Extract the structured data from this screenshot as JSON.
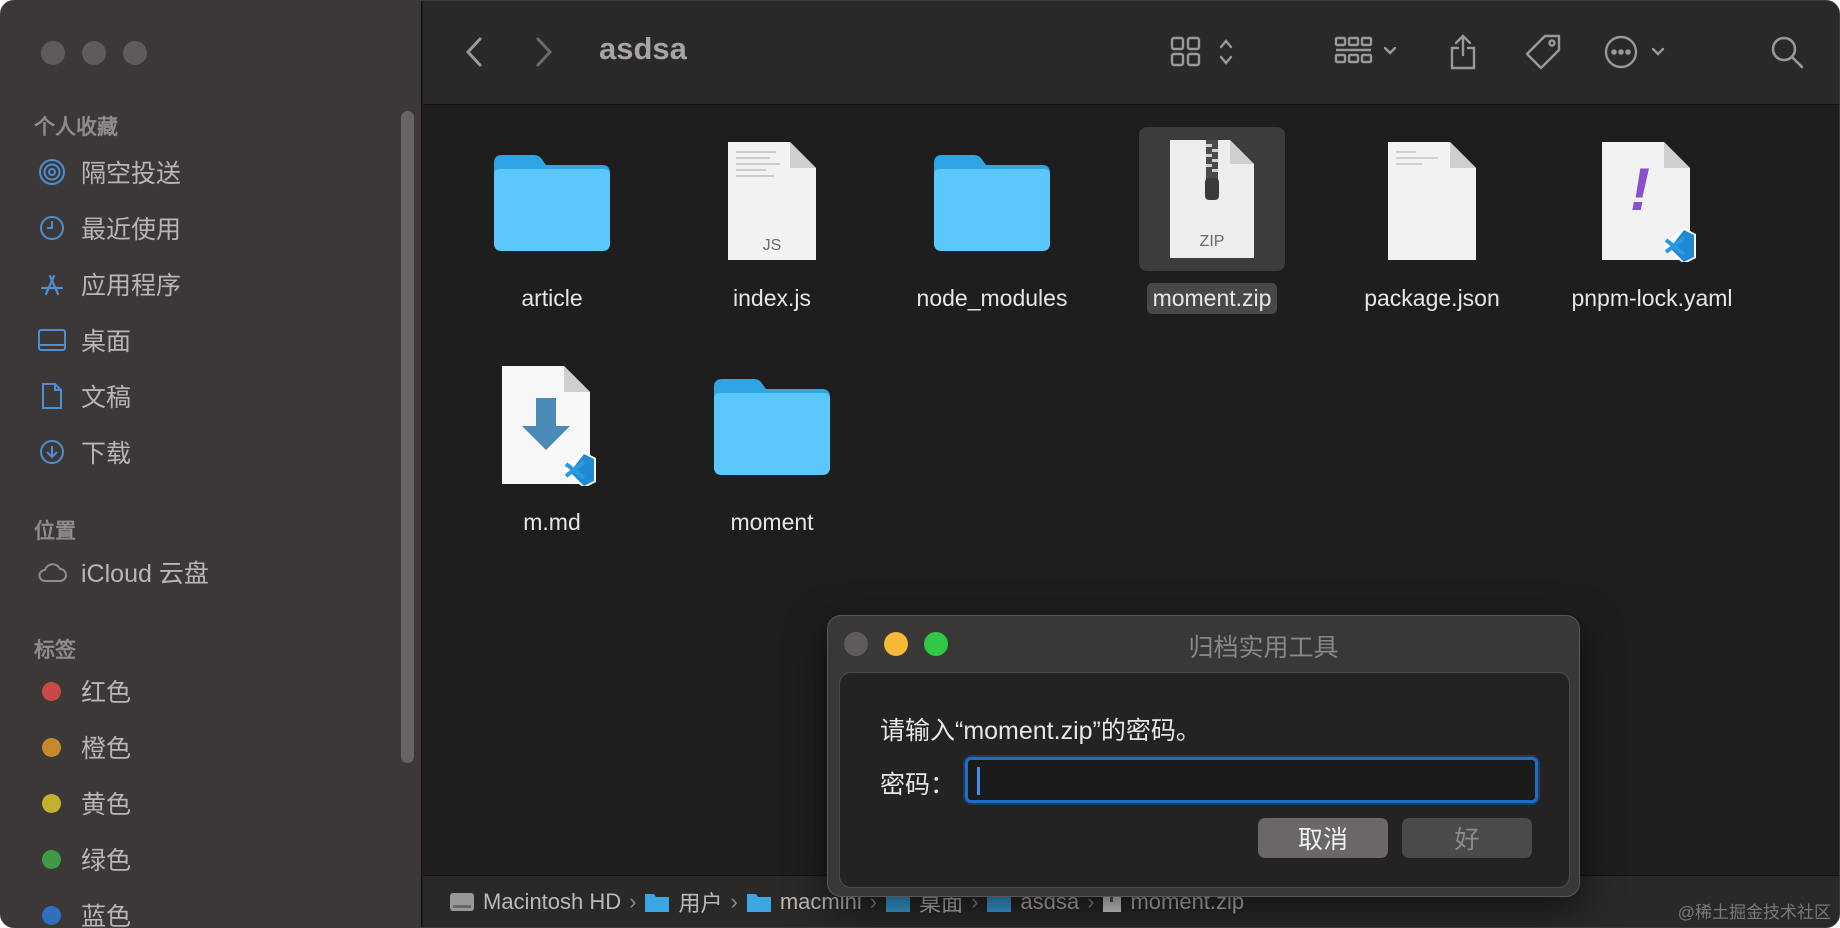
{
  "window": {
    "folder_title": "asdsa"
  },
  "sidebar": {
    "favorites_header": "个人收藏",
    "favorites": [
      {
        "label": "隔空投送",
        "icon": "airdrop-icon"
      },
      {
        "label": "最近使用",
        "icon": "clock-icon"
      },
      {
        "label": "应用程序",
        "icon": "applications-icon"
      },
      {
        "label": "桌面",
        "icon": "desktop-icon"
      },
      {
        "label": "文稿",
        "icon": "document-icon"
      },
      {
        "label": "下载",
        "icon": "download-icon"
      }
    ],
    "locations_header": "位置",
    "locations": [
      {
        "label": "iCloud 云盘",
        "icon": "cloud-icon"
      }
    ],
    "tags_header": "标签",
    "tags": [
      {
        "label": "红色",
        "color": "#c94a45"
      },
      {
        "label": "橙色",
        "color": "#c58a2e"
      },
      {
        "label": "黄色",
        "color": "#c2b12f"
      },
      {
        "label": "绿色",
        "color": "#3f9a45"
      },
      {
        "label": "蓝色",
        "color": "#2f6fbd"
      }
    ]
  },
  "files": [
    {
      "name": "article",
      "kind": "folder-icon"
    },
    {
      "name": "index.js",
      "kind": "js-file-icon",
      "badge": "JS"
    },
    {
      "name": "node_modules",
      "kind": "folder-icon"
    },
    {
      "name": "moment.zip",
      "kind": "zip-file-icon",
      "badge": "ZIP",
      "selected": true
    },
    {
      "name": "package.json",
      "kind": "json-file-icon"
    },
    {
      "name": "pnpm-lock.yaml",
      "kind": "yaml-file-icon",
      "glyph": "!"
    },
    {
      "name": "m.md",
      "kind": "markdown-file-icon"
    },
    {
      "name": "moment",
      "kind": "folder-icon"
    }
  ],
  "pathbar": [
    "Macintosh HD",
    "用户",
    "macmini",
    "桌面",
    "asdsa",
    "moment.zip"
  ],
  "dialog": {
    "title": "归档实用工具",
    "prompt": "请输入“moment.zip”的密码。",
    "password_label": "密码：",
    "password_value": "",
    "cancel_label": "取消",
    "ok_label": "好"
  },
  "watermark": "@稀土掘金技术社区"
}
